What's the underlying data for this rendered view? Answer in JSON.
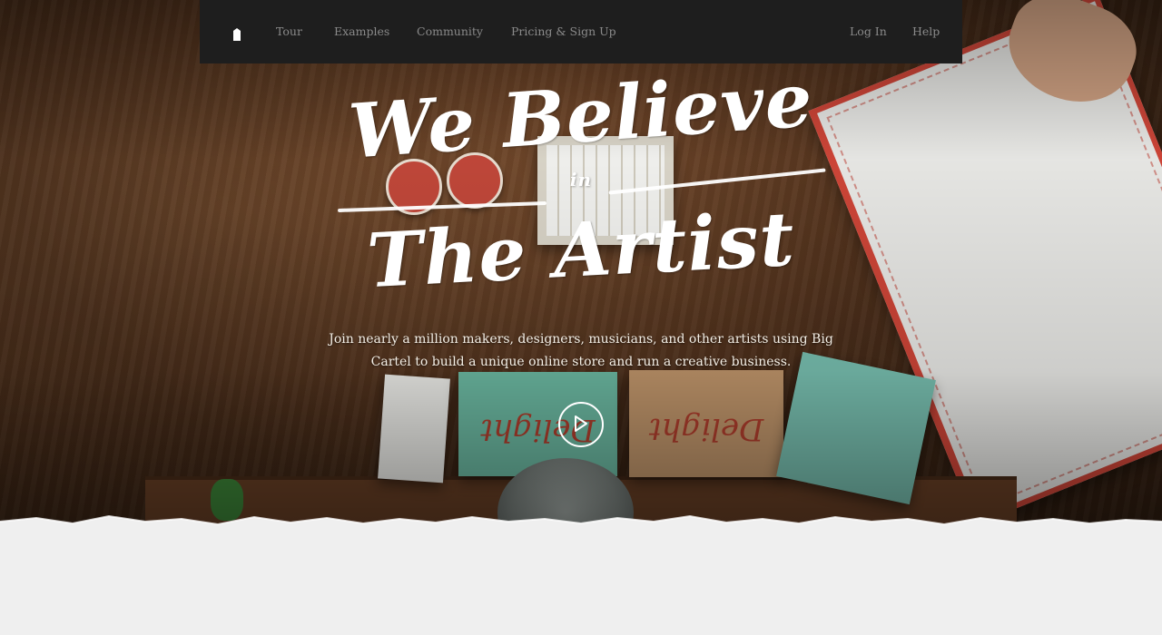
{
  "nav": {
    "links": [
      {
        "label": "Tour"
      },
      {
        "label": "Examples"
      },
      {
        "label": "Community"
      },
      {
        "label": "Pricing & Sign Up"
      }
    ],
    "right_links": [
      {
        "label": "Log In"
      },
      {
        "label": "Help"
      }
    ]
  },
  "hero": {
    "headline": {
      "line1": "We Believe",
      "line2": "in",
      "line3": "The Artist"
    },
    "tagline": "Join nearly a million makers, designers, musicians, and other artists using Big Cartel to build a unique online store and run a creative business.",
    "play_icon": "play-icon"
  },
  "colors": {
    "nav_bg": "#1e1e1e",
    "nav_text": "#8a8a8a",
    "page_bg": "#efefef",
    "text_light": "#ffffff"
  }
}
